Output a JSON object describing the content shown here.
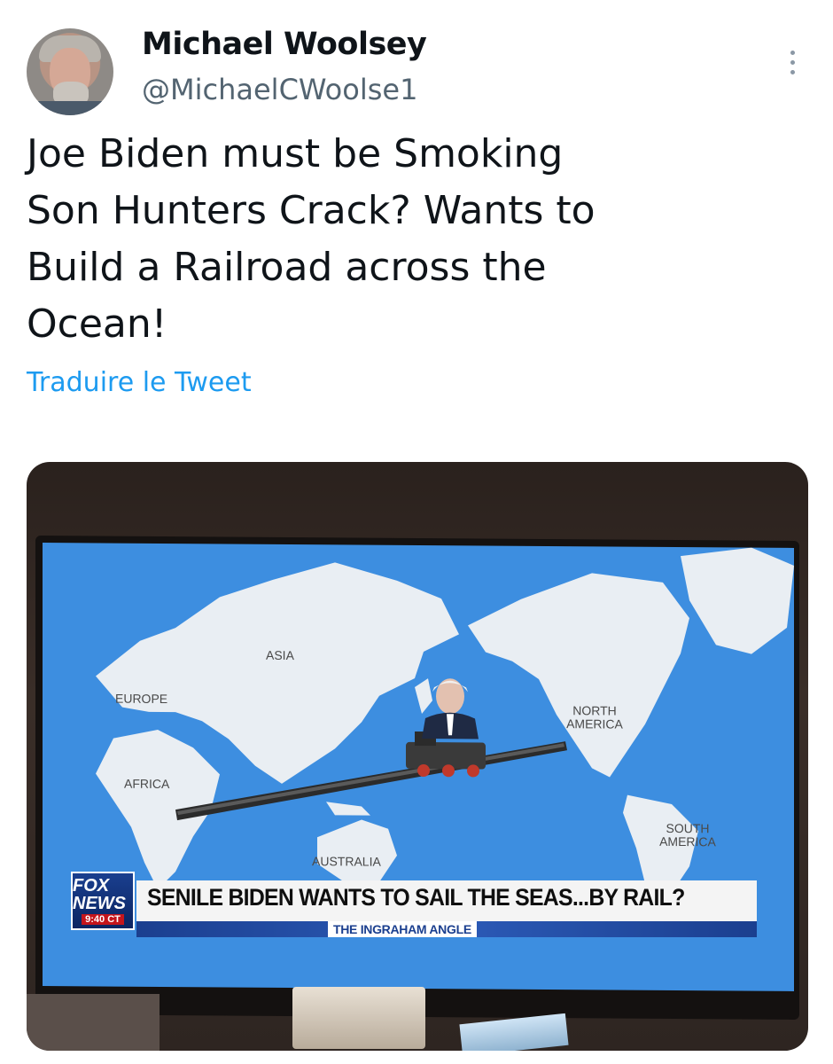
{
  "tweet": {
    "display_name": "Michael Woolsey",
    "handle": "@MichaelCWoolse1",
    "text": "Joe Biden must be Smoking Son Hunters Crack? Wants to Build a Railroad across the Ocean!",
    "translate_label": "Traduire le Tweet",
    "more_icon": "more-vertical-icon"
  },
  "image": {
    "map_labels": {
      "asia": "ASIA",
      "europe": "EUROPE",
      "africa": "AFRICA",
      "australia": "AUSTRALIA",
      "north_america": "NORTH AMERICA",
      "south_america": "SOUTH AMERICA"
    },
    "logo_text": "FOX NEWS",
    "time": "9:40 CT",
    "chyron": "SENILE BIDEN WANTS TO SAIL THE SEAS...BY RAIL?",
    "show": "THE INGRAHAM ANGLE"
  },
  "colors": {
    "name": "#0f1419",
    "handle": "#536471",
    "link": "#1d9bf0",
    "ocean": "#3d8ee0",
    "land": "#e9eef3"
  }
}
